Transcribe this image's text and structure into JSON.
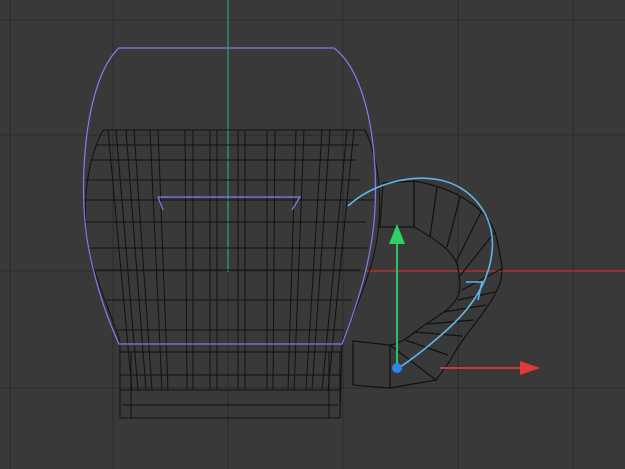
{
  "viewport": {
    "view": "front",
    "background_color": "#393939",
    "grid_color": "#2b2b2b",
    "x_axis_color": "#c9302c",
    "y_axis_color": "#2ea66a",
    "wireframe_color": "#111111",
    "selection_color": "#7b7ff0",
    "spline_color": "#5fb6ea",
    "gizmo_y_color": "#2fd06a",
    "gizmo_x_color": "#e03a3a",
    "gizmo_origin_color": "#2a86e6"
  },
  "scene": {
    "objects": [
      {
        "name": "mug-body",
        "type": "wireframe-mesh",
        "selected": true
      },
      {
        "name": "mug-handle",
        "type": "sweep-along-spline",
        "selected": false
      }
    ],
    "gizmo": {
      "type": "move",
      "axes": [
        "x",
        "y"
      ]
    }
  }
}
